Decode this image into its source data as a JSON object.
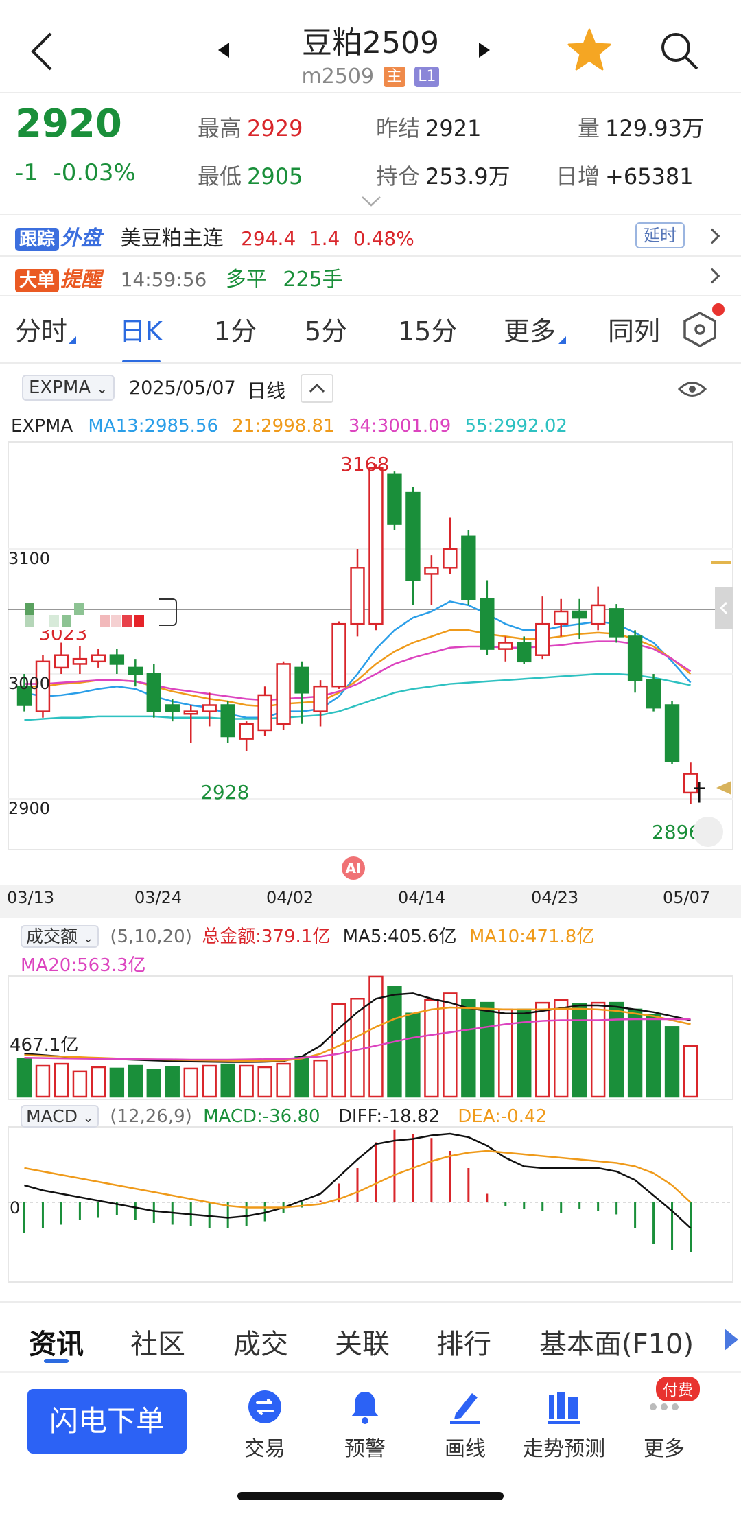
{
  "header": {
    "title": "豆粕2509",
    "code": "m2509",
    "tag_main": "主",
    "tag_level": "L1"
  },
  "quote": {
    "price": "2920",
    "change": "-1",
    "change_pct": "-0.03%",
    "high_label": "最高",
    "high": "2929",
    "low_label": "最低",
    "low": "2905",
    "prev_settle_label": "昨结",
    "prev_settle": "2921",
    "open_int_label": "持仓",
    "open_int": "253.9万",
    "volume_label": "量",
    "volume": "129.93万",
    "daily_inc_label": "日增",
    "daily_inc": "+65381"
  },
  "track_row": {
    "tag1": "跟踪",
    "tag2": "外盘",
    "name": "美豆粕主连",
    "price": "294.4",
    "change": "1.4",
    "change_pct": "0.48%",
    "delay": "延时"
  },
  "bigorder_row": {
    "tag1": "大单",
    "tag2": "提醒",
    "time": "14:59:56",
    "direction": "多平",
    "qty": "225手"
  },
  "period_tabs": [
    "分时",
    "日K",
    "1分",
    "5分",
    "15分",
    "更多",
    "同列"
  ],
  "chart_bar": {
    "indicator": "EXPMA",
    "date": "2025/05/07",
    "period": "日线"
  },
  "expma_legend": {
    "name": "EXPMA",
    "ma13": "MA13:2985.56",
    "ma21": "21:2998.81",
    "ma34": "34:3001.09",
    "ma55": "55:2992.02",
    "colors": {
      "ma13": "#2a9ee8",
      "ma21": "#ef9a1a",
      "ma34": "#dc44bf",
      "ma55": "#2ec1c1"
    }
  },
  "price_axis": {
    "y3100": "3100",
    "y3000": "3000",
    "y2900": "2900"
  },
  "price_annotations": {
    "high": "3168",
    "low1": "2928",
    "low2": "2896",
    "partial": "3023"
  },
  "ai_badge": "AI",
  "date_axis": [
    "03/13",
    "03/24",
    "04/02",
    "04/14",
    "04/23",
    "05/07"
  ],
  "volume_legend": {
    "name": "成交额",
    "params": "(5,10,20)",
    "total": "总金额:379.1亿",
    "ma5": "MA5:405.6亿",
    "ma10": "MA10:471.8亿",
    "ma20": "MA20:563.3亿",
    "axis_label": "467.1亿"
  },
  "macd_legend": {
    "name": "MACD",
    "params": "(12,26,9)",
    "macd": "MACD:-36.80",
    "diff": "DIFF:-18.82",
    "dea": "DEA:-0.42",
    "zero": "0"
  },
  "bottom_tabs": [
    "资讯",
    "社区",
    "成交",
    "关联",
    "排行",
    "基本面(F10)"
  ],
  "bottom_nav": {
    "flash_order": "闪电下单",
    "items": [
      "交易",
      "预警",
      "画线",
      "走势预测",
      "更多"
    ],
    "paid_badge": "付费"
  },
  "colors": {
    "up": "#d9262b",
    "down": "#1a8f3a",
    "accent": "#2c6be0"
  },
  "chart_data": {
    "type": "candlestick",
    "x_range": [
      "03/13",
      "05/07"
    ],
    "y_range": [
      2880,
      3200
    ],
    "candles": [
      {
        "o": 2990,
        "c": 2975,
        "h": 3000,
        "l": 2970
      },
      {
        "o": 2970,
        "c": 3010,
        "h": 3015,
        "l": 2965
      },
      {
        "o": 3005,
        "c": 3015,
        "h": 3025,
        "l": 3000
      },
      {
        "o": 3008,
        "c": 3012,
        "h": 3022,
        "l": 3000
      },
      {
        "o": 3010,
        "c": 3015,
        "h": 3020,
        "l": 3005
      },
      {
        "o": 3015,
        "c": 3008,
        "h": 3020,
        "l": 3000
      },
      {
        "o": 3005,
        "c": 3000,
        "h": 3012,
        "l": 2990
      },
      {
        "o": 3000,
        "c": 2970,
        "h": 3008,
        "l": 2965
      },
      {
        "o": 2975,
        "c": 2970,
        "h": 2980,
        "l": 2962
      },
      {
        "o": 2968,
        "c": 2970,
        "h": 2975,
        "l": 2945
      },
      {
        "o": 2970,
        "c": 2975,
        "h": 2985,
        "l": 2958
      },
      {
        "o": 2975,
        "c": 2950,
        "h": 2978,
        "l": 2945
      },
      {
        "o": 2948,
        "c": 2960,
        "h": 2962,
        "l": 2938
      },
      {
        "o": 2955,
        "c": 2983,
        "h": 2990,
        "l": 2950
      },
      {
        "o": 2960,
        "c": 3008,
        "h": 3010,
        "l": 2955
      },
      {
        "o": 3005,
        "c": 2985,
        "h": 3010,
        "l": 2960
      },
      {
        "o": 2970,
        "c": 2990,
        "h": 2995,
        "l": 2958
      },
      {
        "o": 2990,
        "c": 3040,
        "h": 3042,
        "l": 2988
      },
      {
        "o": 3040,
        "c": 3085,
        "h": 3100,
        "l": 3030
      },
      {
        "o": 3040,
        "c": 3165,
        "h": 3168,
        "l": 3035
      },
      {
        "o": 3160,
        "c": 3120,
        "h": 3162,
        "l": 3115
      },
      {
        "o": 3145,
        "c": 3075,
        "h": 3150,
        "l": 3055
      },
      {
        "o": 3080,
        "c": 3085,
        "h": 3095,
        "l": 3055
      },
      {
        "o": 3085,
        "c": 3100,
        "h": 3125,
        "l": 3080
      },
      {
        "o": 3110,
        "c": 3060,
        "h": 3115,
        "l": 3055
      },
      {
        "o": 3060,
        "c": 3020,
        "h": 3075,
        "l": 3015
      },
      {
        "o": 3020,
        "c": 3025,
        "h": 3030,
        "l": 3010
      },
      {
        "o": 3025,
        "c": 3010,
        "h": 3030,
        "l": 3008
      },
      {
        "o": 3015,
        "c": 3040,
        "h": 3062,
        "l": 3012
      },
      {
        "o": 3040,
        "c": 3050,
        "h": 3060,
        "l": 3030
      },
      {
        "o": 3050,
        "c": 3045,
        "h": 3060,
        "l": 3028
      },
      {
        "o": 3040,
        "c": 3055,
        "h": 3070,
        "l": 3035
      },
      {
        "o": 3052,
        "c": 3030,
        "h": 3056,
        "l": 3025
      },
      {
        "o": 3030,
        "c": 2995,
        "h": 3035,
        "l": 2985
      },
      {
        "o": 2995,
        "c": 2973,
        "h": 3000,
        "l": 2970
      },
      {
        "o": 2975,
        "c": 2930,
        "h": 2978,
        "l": 2928
      },
      {
        "o": 2905,
        "c": 2920,
        "h": 2929,
        "l": 2896
      }
    ],
    "ema_series": [
      {
        "name": "MA13",
        "color": "#2a9ee8",
        "values": [
          2985,
          2982,
          2983,
          2985,
          2988,
          2990,
          2988,
          2982,
          2978,
          2975,
          2973,
          2968,
          2965,
          2965,
          2970,
          2970,
          2972,
          2982,
          3000,
          3020,
          3035,
          3045,
          3050,
          3058,
          3055,
          3048,
          3040,
          3035,
          3035,
          3038,
          3040,
          3042,
          3040,
          3033,
          3025,
          3010,
          2993
        ]
      },
      {
        "name": "21",
        "color": "#ef9a1a",
        "values": [
          2990,
          2990,
          2992,
          2993,
          2995,
          2995,
          2994,
          2990,
          2986,
          2983,
          2980,
          2978,
          2975,
          2974,
          2976,
          2977,
          2978,
          2985,
          2995,
          3008,
          3018,
          3025,
          3030,
          3035,
          3035,
          3032,
          3030,
          3028,
          3028,
          3030,
          3032,
          3033,
          3032,
          3028,
          3022,
          3012,
          3000
        ]
      },
      {
        "name": "34",
        "color": "#dc44bf",
        "values": [
          2992,
          2992,
          2993,
          2994,
          2995,
          2995,
          2994,
          2991,
          2988,
          2986,
          2984,
          2982,
          2980,
          2979,
          2980,
          2981,
          2982,
          2986,
          2992,
          3000,
          3008,
          3013,
          3017,
          3021,
          3022,
          3022,
          3021,
          3021,
          3022,
          3023,
          3025,
          3026,
          3026,
          3024,
          3020,
          3012,
          3002
        ]
      },
      {
        "name": "55",
        "color": "#2ec1c1",
        "values": [
          2963,
          2964,
          2965,
          2965,
          2966,
          2966,
          2966,
          2966,
          2965,
          2965,
          2965,
          2964,
          2964,
          2964,
          2965,
          2966,
          2967,
          2970,
          2975,
          2980,
          2985,
          2988,
          2990,
          2992,
          2993,
          2994,
          2995,
          2996,
          2997,
          2998,
          2999,
          3000,
          3000,
          2999,
          2997,
          2994,
          2991
        ]
      }
    ],
    "volume": {
      "unit": "亿",
      "values": [
        280,
        230,
        245,
        190,
        220,
        210,
        230,
        200,
        220,
        210,
        230,
        240,
        230,
        220,
        245,
        300,
        270,
        690,
        730,
        895,
        820,
        620,
        720,
        770,
        720,
        700,
        650,
        650,
        700,
        720,
        690,
        700,
        700,
        650,
        610,
        520,
        379
      ],
      "ma_series": [
        {
          "name": "MA5",
          "color": "#111111",
          "values": [
            320,
            310,
            300,
            290,
            285,
            280,
            275,
            270,
            265,
            262,
            260,
            258,
            258,
            260,
            265,
            300,
            380,
            510,
            630,
            730,
            760,
            770,
            730,
            700,
            660,
            640,
            620,
            620,
            640,
            660,
            680,
            680,
            670,
            650,
            630,
            600,
            570
          ]
        },
        {
          "name": "MA10",
          "color": "#ef9a1a",
          "values": [
            310,
            305,
            300,
            295,
            290,
            285,
            280,
            278,
            275,
            272,
            270,
            268,
            266,
            268,
            270,
            285,
            320,
            380,
            450,
            520,
            580,
            620,
            650,
            665,
            660,
            655,
            650,
            650,
            650,
            655,
            655,
            650,
            640,
            620,
            600,
            570,
            540
          ]
        },
        {
          "name": "MA20",
          "color": "#dc44bf",
          "values": [
            290,
            288,
            286,
            284,
            282,
            280,
            280,
            279,
            278,
            276,
            276,
            276,
            278,
            280,
            282,
            290,
            300,
            320,
            350,
            380,
            410,
            440,
            460,
            480,
            500,
            520,
            540,
            555,
            565,
            570,
            570,
            570,
            575,
            578,
            578,
            578,
            578
          ]
        }
      ]
    },
    "macd": {
      "zero_label": "0",
      "hist": [
        -36,
        -30,
        -26,
        -20,
        -18,
        -15,
        -20,
        -24,
        -26,
        -28,
        -30,
        -30,
        -28,
        -22,
        -12,
        -6,
        2,
        22,
        40,
        70,
        85,
        80,
        75,
        60,
        40,
        10,
        -4,
        -8,
        -10,
        -12,
        -8,
        -10,
        -14,
        -30,
        -48,
        -56,
        -58
      ],
      "diff": [
        20,
        14,
        10,
        6,
        2,
        -2,
        -6,
        -10,
        -12,
        -14,
        -16,
        -18,
        -16,
        -12,
        -6,
        2,
        10,
        30,
        50,
        68,
        72,
        74,
        78,
        80,
        76,
        66,
        52,
        42,
        40,
        40,
        40,
        40,
        36,
        26,
        8,
        -10,
        -30
      ],
      "dea": [
        40,
        36,
        32,
        28,
        24,
        20,
        16,
        12,
        8,
        4,
        0,
        -4,
        -6,
        -6,
        -6,
        -4,
        -2,
        4,
        12,
        22,
        32,
        40,
        48,
        54,
        58,
        60,
        58,
        56,
        54,
        52,
        50,
        48,
        46,
        42,
        34,
        20,
        0
      ]
    }
  }
}
